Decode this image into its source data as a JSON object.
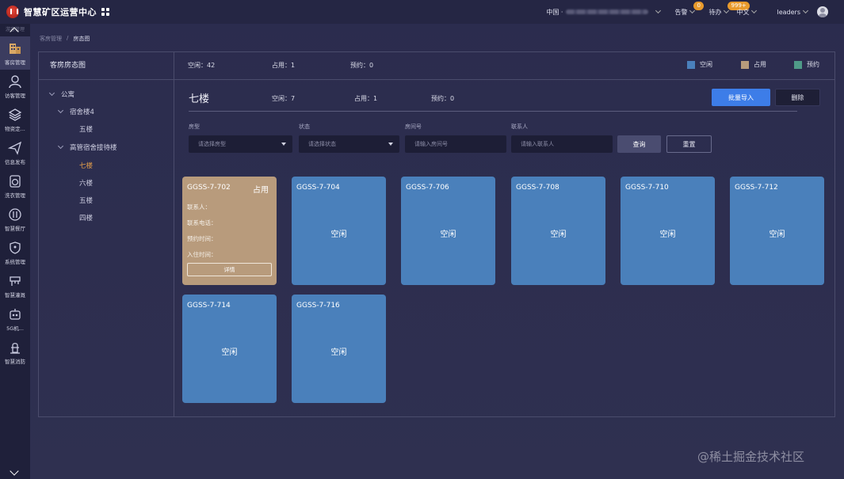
{
  "app": {
    "title": "智慧矿区运营中心"
  },
  "topbar": {
    "region_label": "中国 ·",
    "alarm_label": "告警",
    "alarm_count": "0",
    "todo_label": "待办",
    "todo_count": "999+",
    "language": "中文",
    "user": "leaders"
  },
  "sidebar": {
    "top_label": "游客管理",
    "items": [
      {
        "label": "客房管理",
        "icon": "building-icon"
      },
      {
        "label": "访客管理",
        "icon": "visitor-icon"
      },
      {
        "label": "物资定...",
        "icon": "layers-icon"
      },
      {
        "label": "信息发布",
        "icon": "send-icon"
      },
      {
        "label": "洗衣管理",
        "icon": "washer-icon"
      },
      {
        "label": "智慧餐厅",
        "icon": "dining-icon"
      },
      {
        "label": "系统管理",
        "icon": "shield-icon"
      },
      {
        "label": "智慧灌溉",
        "icon": "irrigation-icon"
      },
      {
        "label": "5G机...",
        "icon": "robot-icon"
      },
      {
        "label": "智慧消防",
        "icon": "fire-hydrant-icon"
      }
    ]
  },
  "breadcrumb": {
    "parent": "客房管理",
    "separator": "/",
    "current": "房态图"
  },
  "panel": {
    "title": "客房房态图",
    "summary": {
      "free": "空闲：42",
      "occupied": "占用：1",
      "reserved": "预约：0"
    },
    "legend": [
      {
        "label": "空闲",
        "color": "#4a80bb"
      },
      {
        "label": "占用",
        "color": "#b89b7c"
      },
      {
        "label": "预约",
        "color": "#4f9a88"
      }
    ]
  },
  "tree": {
    "root": "公寓",
    "building1": "宿舍楼4",
    "building1_floor": "五楼",
    "building2": "高管宿舍接待楼",
    "floors": [
      "七楼",
      "六楼",
      "五楼",
      "四楼"
    ]
  },
  "floor": {
    "title": "七楼",
    "free": "空闲：7",
    "occupied": "占用：1",
    "reserved": "预约：0",
    "import_button": "批量导入",
    "delete_button": "删除"
  },
  "filters": {
    "room_type_label": "房型",
    "room_type_placeholder": "请选择房型",
    "status_label": "状态",
    "status_placeholder": "请选择状态",
    "room_no_label": "房间号",
    "room_no_placeholder": "请输入房间号",
    "contact_label": "联系人",
    "contact_placeholder": "请输入联系人",
    "query_button": "查询",
    "reset_button": "重置"
  },
  "rooms": [
    {
      "code": "GGSS-7-702",
      "status": "占用",
      "contact_label": "联系人：",
      "phone_label": "联系电话：",
      "reserve_label": "预约时间：",
      "checkin_label": "入住时间：",
      "detail_button": "详情"
    },
    {
      "code": "GGSS-7-704",
      "status": "空闲"
    },
    {
      "code": "GGSS-7-706",
      "status": "空闲"
    },
    {
      "code": "GGSS-7-708",
      "status": "空闲"
    },
    {
      "code": "GGSS-7-710",
      "status": "空闲"
    },
    {
      "code": "GGSS-7-712",
      "status": "空闲"
    },
    {
      "code": "GGSS-7-714",
      "status": "空闲"
    },
    {
      "code": "GGSS-7-716",
      "status": "空闲"
    }
  ],
  "watermark": "@稀土掘金技术社区"
}
